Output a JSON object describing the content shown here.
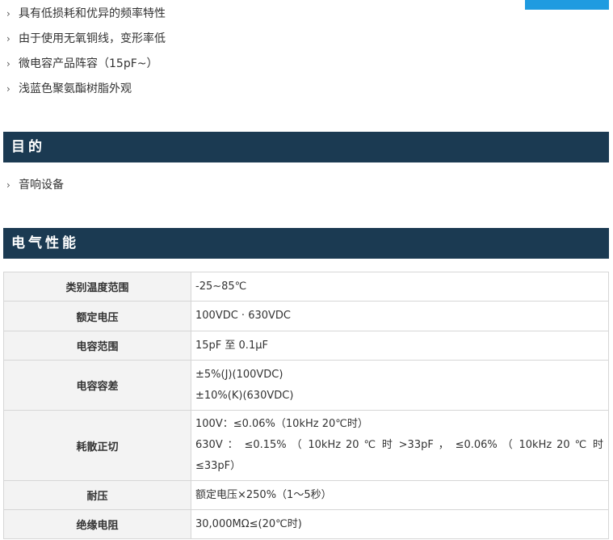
{
  "features": [
    "具有低损耗和优异的频率特性",
    "由于使用无氧铜线，变形率低",
    "微电容产品阵容（15pF~）",
    "浅蓝色聚氨酯树脂外观"
  ],
  "purpose": {
    "title": "目的",
    "items": [
      "音响设备"
    ]
  },
  "electrical": {
    "title": "电气性能",
    "rows": [
      {
        "label": "类别温度范围",
        "values": [
          "-25~85℃"
        ]
      },
      {
        "label": "额定电压",
        "values": [
          "100VDC · 630VDC"
        ]
      },
      {
        "label": "电容范围",
        "values": [
          "15pF 至 0.1μF"
        ]
      },
      {
        "label": "电容容差",
        "values": [
          "±5%(J)(100VDC)",
          "±10%(K)(630VDC)"
        ]
      },
      {
        "label": "耗散正切",
        "values": [
          "100V：≤0.06%（10kHz 20℃时）",
          "630V ： ≤0.15% （ 10kHz 20 ℃ 时 >33pF ， ≤0.06% （ 10kHz 20 ℃ 时",
          "≤33pF）"
        ]
      },
      {
        "label": "耐压",
        "values": [
          "额定电压×250%（1～5秒）"
        ]
      },
      {
        "label": "绝缘电阻",
        "values": [
          "30,000MΩ≤(20℃时)"
        ]
      }
    ]
  },
  "colors": {
    "section_bar": "#1b3a52",
    "accent_tab": "#1f9be0"
  }
}
